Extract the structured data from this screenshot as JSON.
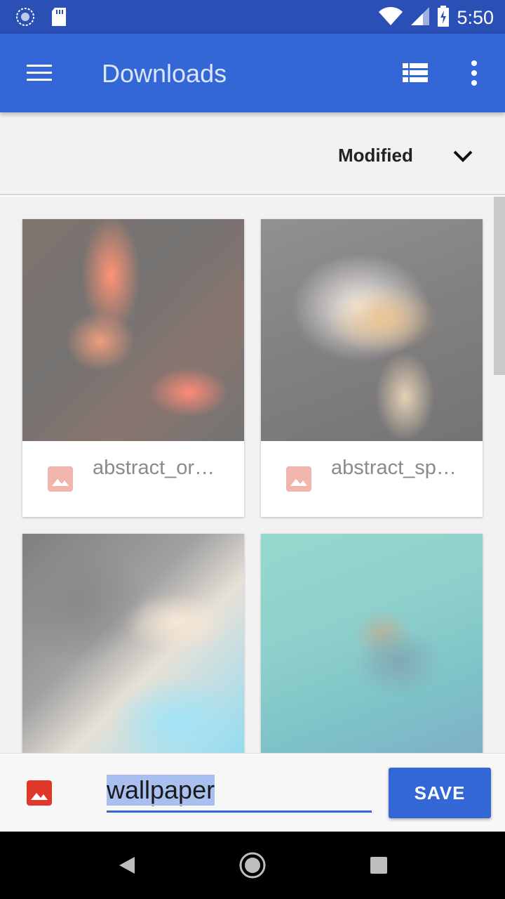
{
  "status_bar": {
    "time": "5:50",
    "icons": [
      "sync-icon",
      "sd-card-icon",
      "wifi-icon",
      "signal-icon",
      "battery-charging-icon"
    ]
  },
  "app_bar": {
    "title": "Downloads",
    "icons": [
      "menu-icon",
      "list-view-icon",
      "more-vert-icon"
    ],
    "color": "#3367d6"
  },
  "sort": {
    "label": "Modified",
    "icon": "chevron-down-icon"
  },
  "files": [
    {
      "name": "abstract_or…",
      "icon": "image-icon"
    },
    {
      "name": "abstract_sp…",
      "icon": "image-icon"
    },
    {
      "name": "",
      "icon": "image-icon"
    },
    {
      "name": "",
      "icon": "image-icon"
    }
  ],
  "save_bar": {
    "filename": "wallpaper",
    "save_label": "SAVE",
    "icon": "image-icon",
    "accent": "#3367d6"
  },
  "nav_bar": {
    "icons": [
      "back-icon",
      "home-icon",
      "recents-icon"
    ]
  }
}
